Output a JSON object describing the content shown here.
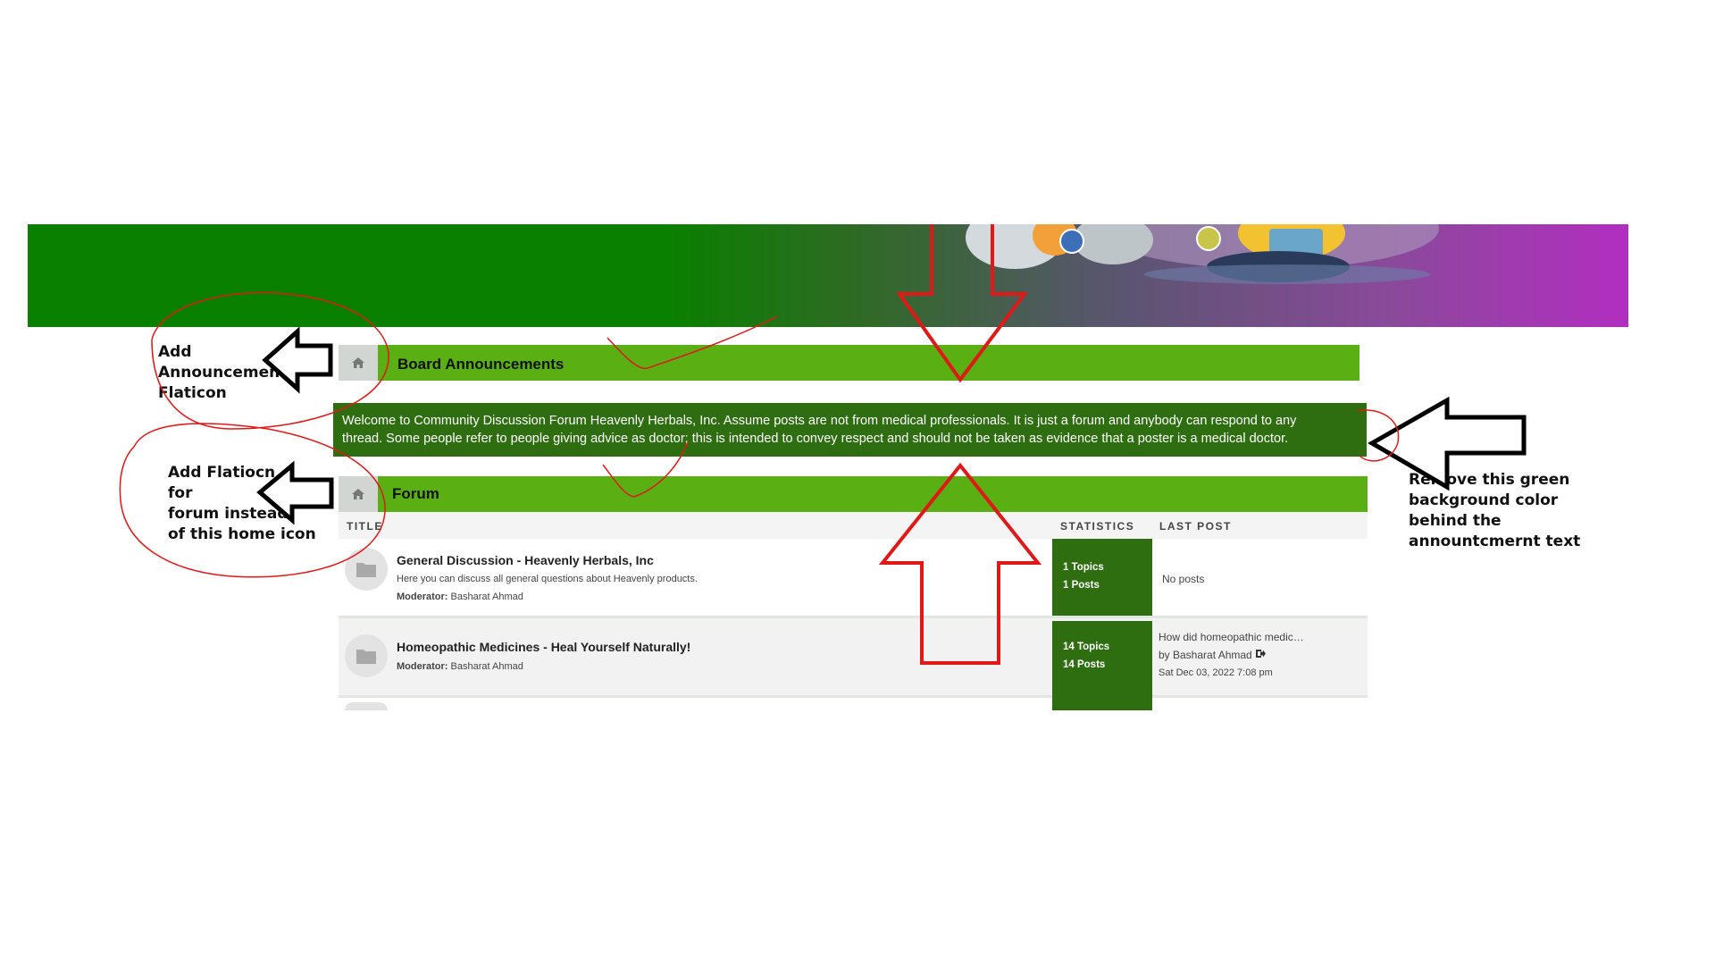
{
  "board": {
    "announcements_title": "Board Announcements",
    "announcement_text_line1": "Welcome to Community Discussion Forum Heavenly Herbals, Inc. Assume posts are not from medical professionals. It is just a forum and anybody can respond to any",
    "announcement_text_line2": "thread. Some people refer to people giving advice as doctor; this is intended to convey respect and should not be taken as evidence that a poster is a medical doctor.",
    "forum_title": "Forum"
  },
  "table": {
    "headers": {
      "title": "TITLE",
      "statistics": "STATISTICS",
      "last_post": "LAST POST"
    },
    "rows": [
      {
        "title": "General Discussion - Heavenly Herbals, Inc",
        "description": "Here you can discuss all general questions about Heavenly products.",
        "moderator_label": "Moderator:",
        "moderator": "Basharat Ahmad",
        "topics": "1 Topics",
        "posts": "1 Posts",
        "last_post": "No posts"
      },
      {
        "title": "Homeopathic Medicines - Heal Yourself Naturally!",
        "description": "",
        "moderator_label": "Moderator:",
        "moderator": "Basharat Ahmad",
        "topics": "14 Topics",
        "posts": "14 Posts",
        "last_post_title": "How did homeopathic medic…",
        "last_post_by": "by Basharat Ahmad",
        "last_post_date": "Sat Dec 03, 2022 7:08 pm"
      }
    ]
  },
  "notes": {
    "announcement_icon": [
      "Add",
      "Announcement",
      "Flaticon"
    ],
    "forum_icon": [
      "Add Flatiocn",
      "for",
      "forum instead",
      "of this home icon"
    ],
    "remove_bg": [
      "Remove this green",
      "background color",
      "behind the",
      "annountcmernt text"
    ]
  },
  "icons": {
    "home": "home-icon",
    "folder": "folder-icon",
    "goto": "goto-post-icon"
  },
  "colors": {
    "section_bar": "#5ab013",
    "announcement_bg": "#2e6e10",
    "stat_bg": "#2e6e10",
    "banner_start": "#0a8000",
    "banner_end": "#b22ec0",
    "annotation_red": "#e01818"
  }
}
